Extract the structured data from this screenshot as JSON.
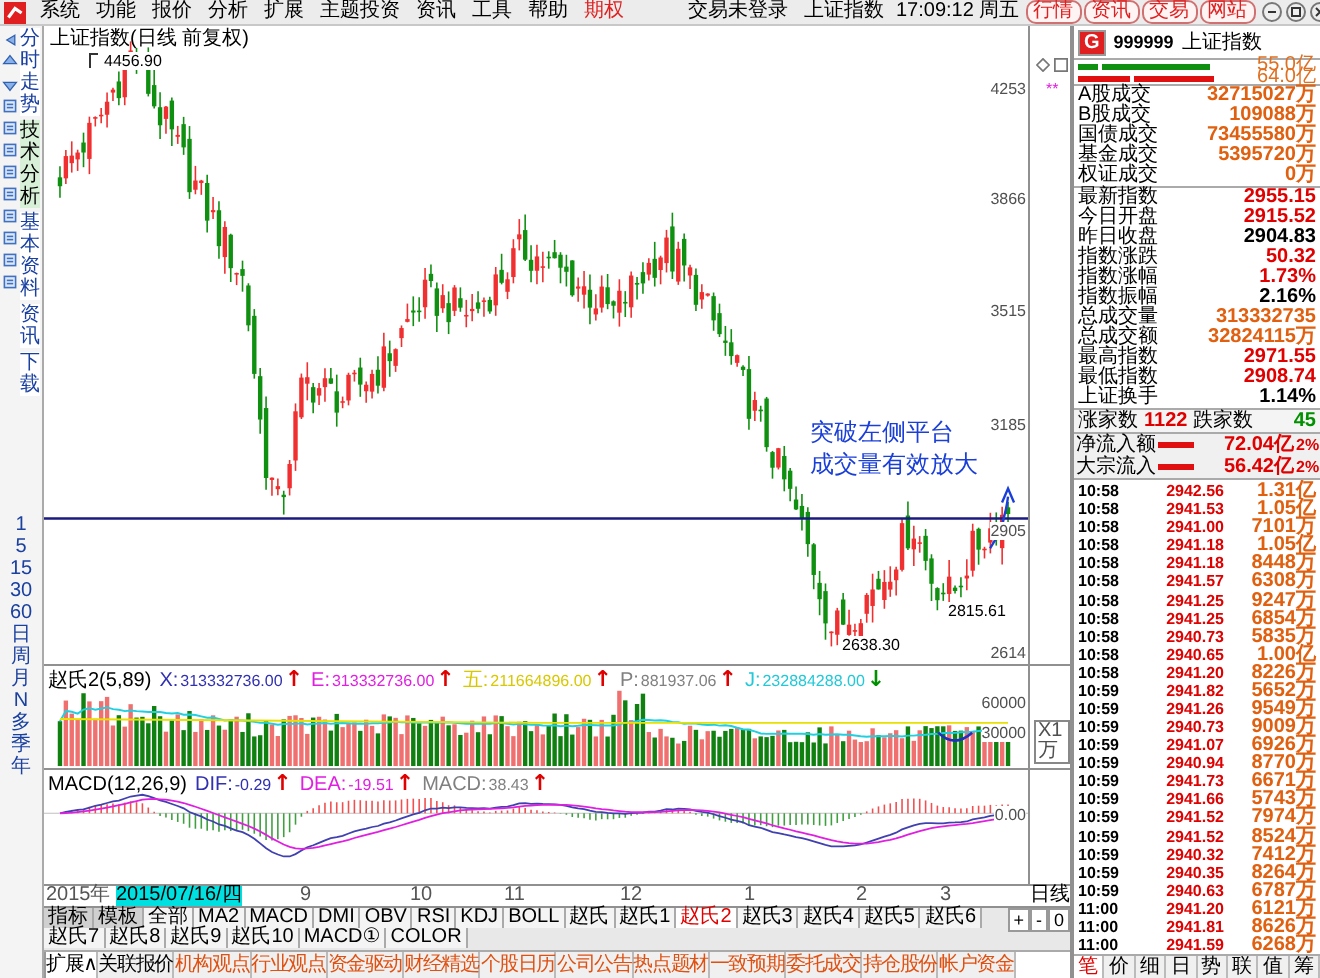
{
  "menu_bar": {
    "items": [
      {
        "label": "系统",
        "kind": "normal"
      },
      {
        "label": "功能",
        "kind": "normal"
      },
      {
        "label": "报价",
        "kind": "normal"
      },
      {
        "label": "分析",
        "kind": "normal"
      },
      {
        "label": "扩展",
        "kind": "normal"
      },
      {
        "label": "主题投资",
        "kind": "normal"
      },
      {
        "label": "资讯",
        "kind": "normal"
      },
      {
        "label": "工具",
        "kind": "normal"
      },
      {
        "label": "帮助",
        "kind": "normal"
      },
      {
        "label": "期权",
        "kind": "highlight"
      }
    ],
    "status": "交易未登录",
    "security": "上证指数",
    "clock": "17:09:12 周五",
    "buttons": [
      "行情",
      "资讯",
      "交易",
      "网站"
    ]
  },
  "left_bar": {
    "tabs": [
      {
        "label": "分时走势",
        "selected": false
      },
      {
        "label": "技术分析",
        "selected": true
      },
      {
        "label": "基本资料",
        "selected": false
      },
      {
        "label": "资讯",
        "selected": false
      },
      {
        "label": "下载",
        "selected": false
      }
    ],
    "periods": [
      "1",
      "5",
      "15",
      "30",
      "60",
      "日",
      "周",
      "月",
      "N",
      "多",
      "季",
      "年"
    ]
  },
  "chart": {
    "title": "上证指数(日线 前复权)",
    "high_label": "4456.90",
    "low_label": "2638.30",
    "recent_low_label": "2815.61",
    "annotation": [
      "突破左侧平台",
      "成交量有效放大"
    ],
    "price_axis": [
      "4253",
      "3866",
      "3515",
      "3185",
      "2905",
      "2614"
    ],
    "marker": "**"
  },
  "volume": {
    "name": "赵氏2(5,89)",
    "fields": [
      {
        "label": "X:",
        "value": "313332736.00",
        "arrow": {
          "text": "↑",
          "color": "#e00000"
        },
        "color": "#3030b0"
      },
      {
        "label": "E:",
        "value": "313332736.00",
        "arrow": {
          "text": "↑",
          "color": "#e00000"
        },
        "color": "#e020e0"
      },
      {
        "label": "五:",
        "value": "211664896.00",
        "arrow": {
          "text": "↑",
          "color": "#e00000"
        },
        "color": "#d8c800"
      },
      {
        "label": "P:",
        "value": "881937.06",
        "arrow": {
          "text": "↑",
          "color": "#e00000"
        },
        "color": "#808080"
      },
      {
        "label": "J:",
        "value": "232884288.00",
        "arrow": {
          "text": "↓",
          "color": "#009000"
        },
        "color": "#20c8d8"
      }
    ],
    "axis": [
      "60000",
      "30000"
    ],
    "unit": "X1万"
  },
  "macd": {
    "name": "MACD(12,26,9)",
    "fields": [
      {
        "label": "DIF:",
        "value": "-0.29",
        "arrow": {
          "text": "↑",
          "color": "#e00000"
        },
        "color": "#3030b0"
      },
      {
        "label": "DEA:",
        "value": "-19.51",
        "arrow": {
          "text": "↑",
          "color": "#e00000"
        },
        "color": "#e020e0"
      },
      {
        "label": "MACD:",
        "value": "38.43",
        "arrow": {
          "text": "↑",
          "color": "#e00000"
        },
        "color": "#808080"
      }
    ],
    "axis": [
      "0.00"
    ]
  },
  "date_axis": {
    "labels": [
      {
        "label": "2015年",
        "highlighted": false
      },
      {
        "label": "2015/07/16/四",
        "highlighted": true
      },
      {
        "label": "9",
        "highlighted": false
      },
      {
        "label": "10",
        "highlighted": false
      },
      {
        "label": "11",
        "highlighted": false
      },
      {
        "label": "12",
        "highlighted": false
      },
      {
        "label": "1",
        "highlighted": false
      },
      {
        "label": "2",
        "highlighted": false
      },
      {
        "label": "3",
        "highlighted": false
      }
    ],
    "period": "日线"
  },
  "indicator_tabs": [
    {
      "label": "指标",
      "kind": "head",
      "selected": false
    },
    {
      "label": "模板",
      "kind": "head",
      "selected": false
    },
    {
      "label": "全部",
      "kind": "tab",
      "selected": false
    },
    {
      "label": "MA2",
      "kind": "tab",
      "selected": false
    },
    {
      "label": "MACD",
      "kind": "tab",
      "selected": false
    },
    {
      "label": "DMI",
      "kind": "tab",
      "selected": false
    },
    {
      "label": "OBV",
      "kind": "tab",
      "selected": false
    },
    {
      "label": "RSI",
      "kind": "tab",
      "selected": false
    },
    {
      "label": "KDJ",
      "kind": "tab",
      "selected": false
    },
    {
      "label": "BOLL",
      "kind": "tab",
      "selected": false
    },
    {
      "label": "赵氏",
      "kind": "tab",
      "selected": false
    },
    {
      "label": "赵氏1",
      "kind": "tab",
      "selected": false
    },
    {
      "label": "赵氏2",
      "kind": "tab",
      "selected": true
    },
    {
      "label": "赵氏3",
      "kind": "tab",
      "selected": false
    },
    {
      "label": "赵氏4",
      "kind": "tab",
      "selected": false
    },
    {
      "label": "赵氏5",
      "kind": "tab",
      "selected": false
    },
    {
      "label": "赵氏6",
      "kind": "tab",
      "selected": false
    },
    {
      "label": "赵氏7",
      "kind": "tab",
      "selected": false
    },
    {
      "label": "赵氏8",
      "kind": "tab",
      "selected": false
    },
    {
      "label": "赵氏9",
      "kind": "tab",
      "selected": false
    },
    {
      "label": "赵氏10",
      "kind": "tab",
      "selected": false
    },
    {
      "label": "MACD①",
      "kind": "tab",
      "selected": false
    },
    {
      "label": "COLOR",
      "kind": "tab",
      "selected": false
    }
  ],
  "zoom_buttons": [
    "+",
    "-",
    "0"
  ],
  "bottom_tabs": [
    {
      "label": "扩展∧",
      "kind": "plain",
      "selected": true
    },
    {
      "label": "关联报价",
      "kind": "plain",
      "selected": false
    },
    {
      "label": "机构观点",
      "kind": "link",
      "selected": false
    },
    {
      "label": "行业观点",
      "kind": "link",
      "selected": false
    },
    {
      "label": "资金驱动",
      "kind": "link",
      "selected": false
    },
    {
      "label": "财经精选",
      "kind": "link",
      "selected": false
    },
    {
      "label": "个股日历",
      "kind": "link",
      "selected": false
    },
    {
      "label": "公司公告",
      "kind": "link",
      "selected": false
    },
    {
      "label": "热点题材",
      "kind": "link",
      "selected": false
    },
    {
      "label": "一致预期",
      "kind": "link",
      "selected": false
    },
    {
      "label": "委托成交",
      "kind": "link",
      "selected": false
    },
    {
      "label": "持仓股份",
      "kind": "link",
      "selected": false
    },
    {
      "label": "帐户资金",
      "kind": "link",
      "selected": false
    }
  ],
  "quote": {
    "badge": "G",
    "code": "999999",
    "name": "上证指数",
    "flow_bars": [
      {
        "kind": "outflow",
        "value": "55.0亿"
      },
      {
        "kind": "inflow",
        "value": "64.0亿"
      }
    ],
    "volume_rows": [
      {
        "label": "A股成交",
        "value": "32715027万"
      },
      {
        "label": "B股成交",
        "value": "109088万"
      },
      {
        "label": "国债成交",
        "value": "73455580万"
      },
      {
        "label": "基金成交",
        "value": "5395720万"
      },
      {
        "label": "权证成交",
        "value": "0万"
      }
    ],
    "index_rows": [
      {
        "label": "最新指数",
        "value": "2955.15",
        "color": "#e00000"
      },
      {
        "label": "今日开盘",
        "value": "2915.52",
        "color": "#e00000"
      },
      {
        "label": "昨日收盘",
        "value": "2904.83",
        "color": "#000000"
      },
      {
        "label": "指数涨跌",
        "value": "50.32",
        "color": "#e00000"
      },
      {
        "label": "指数涨幅",
        "value": "1.73%",
        "color": "#e00000"
      },
      {
        "label": "指数振幅",
        "value": "2.16%",
        "color": "#000000"
      },
      {
        "label": "总成交量",
        "value": "313332735",
        "color": "#e06010"
      },
      {
        "label": "总成交额",
        "value": "32824115万",
        "color": "#e06010"
      },
      {
        "label": "最高指数",
        "value": "2971.55",
        "color": "#e00000"
      },
      {
        "label": "最低指数",
        "value": "2908.74",
        "color": "#e00000"
      },
      {
        "label": "上证换手",
        "value": "1.14%",
        "color": "#000000"
      }
    ],
    "breadth": {
      "up_label": "涨家数",
      "up": "1122",
      "down_label": "跌家数",
      "down": "45"
    },
    "flows": [
      {
        "label": "净流入额",
        "value": "72.04亿",
        "share": "2%"
      },
      {
        "label": "大宗流入",
        "value": "56.42亿",
        "share": "2%"
      }
    ],
    "ticks": [
      {
        "time": "10:58",
        "price": "2942.56",
        "amount": "1.31亿"
      },
      {
        "time": "10:58",
        "price": "2941.53",
        "amount": "1.05亿"
      },
      {
        "time": "10:58",
        "price": "2941.00",
        "amount": "7101万"
      },
      {
        "time": "10:58",
        "price": "2941.18",
        "amount": "1.05亿"
      },
      {
        "time": "10:58",
        "price": "2941.18",
        "amount": "8448万"
      },
      {
        "time": "10:58",
        "price": "2941.57",
        "amount": "6308万"
      },
      {
        "time": "10:58",
        "price": "2941.25",
        "amount": "9247万"
      },
      {
        "time": "10:58",
        "price": "2941.25",
        "amount": "6854万"
      },
      {
        "time": "10:58",
        "price": "2940.73",
        "amount": "5835万"
      },
      {
        "time": "10:58",
        "price": "2940.65",
        "amount": "1.00亿"
      },
      {
        "time": "10:58",
        "price": "2941.20",
        "amount": "8226万"
      },
      {
        "time": "10:59",
        "price": "2941.82",
        "amount": "5652万"
      },
      {
        "time": "10:59",
        "price": "2941.26",
        "amount": "9549万"
      },
      {
        "time": "10:59",
        "price": "2940.73",
        "amount": "9009万"
      },
      {
        "time": "10:59",
        "price": "2941.07",
        "amount": "6926万"
      },
      {
        "time": "10:59",
        "price": "2940.94",
        "amount": "8770万"
      },
      {
        "time": "10:59",
        "price": "2941.73",
        "amount": "6671万"
      },
      {
        "time": "10:59",
        "price": "2941.66",
        "amount": "5743万"
      },
      {
        "time": "10:59",
        "price": "2941.52",
        "amount": "7974万"
      },
      {
        "time": "10:59",
        "price": "2941.52",
        "amount": "8524万"
      },
      {
        "time": "10:59",
        "price": "2940.32",
        "amount": "7412万"
      },
      {
        "time": "10:59",
        "price": "2940.35",
        "amount": "8264万"
      },
      {
        "time": "10:59",
        "price": "2940.63",
        "amount": "6787万"
      },
      {
        "time": "11:00",
        "price": "2941.20",
        "amount": "6121万"
      },
      {
        "time": "11:00",
        "price": "2941.81",
        "amount": "8626万"
      },
      {
        "time": "11:00",
        "price": "2941.59",
        "amount": "6268万"
      }
    ],
    "tabs": [
      {
        "label": "笔",
        "selected": true
      },
      {
        "label": "价",
        "selected": false
      },
      {
        "label": "细",
        "selected": false
      },
      {
        "label": "日",
        "selected": false
      },
      {
        "label": "势",
        "selected": false
      },
      {
        "label": "联",
        "selected": false
      },
      {
        "label": "值",
        "selected": false
      },
      {
        "label": "筹",
        "selected": false
      }
    ]
  }
}
